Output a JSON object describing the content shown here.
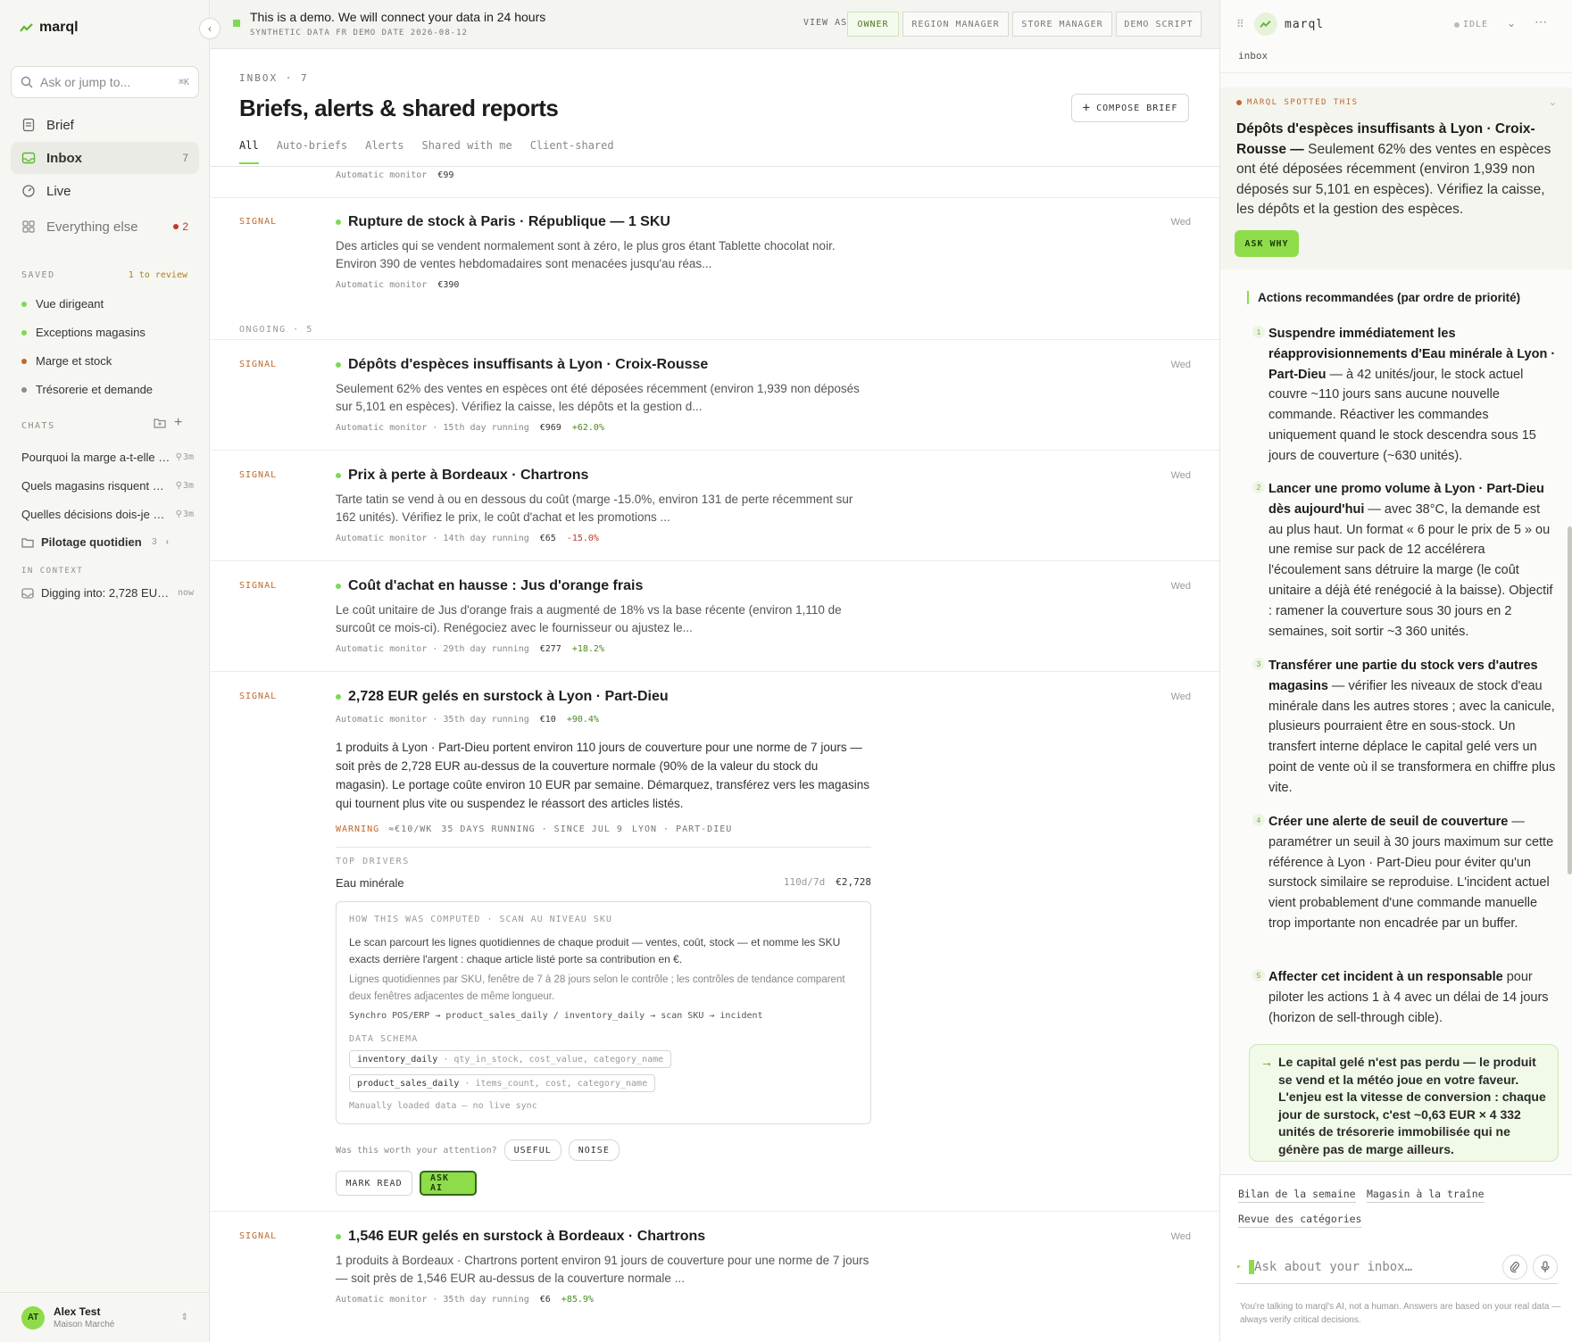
{
  "app": {
    "name": "marql"
  },
  "sidebar": {
    "search_placeholder": "Ask or jump to...",
    "search_shortcut": "⌘K",
    "nav": [
      {
        "label": "Brief"
      },
      {
        "label": "Inbox",
        "count": "7"
      },
      {
        "label": "Live"
      },
      {
        "label": "Everything else",
        "badge": "2"
      }
    ],
    "saved_label": "SAVED",
    "saved_aux": "1 to review",
    "saved": [
      {
        "label": "Vue dirigeant",
        "color": "#7ed957"
      },
      {
        "label": "Exceptions magasins",
        "color": "#7ed957"
      },
      {
        "label": "Marge et stock",
        "color": "#c0682b"
      },
      {
        "label": "Trésorerie et demande",
        "color": "#8d8d88"
      }
    ],
    "chats_label": "CHATS",
    "chats": [
      {
        "title": "Pourquoi la marge a-t-elle baissé",
        "meta": "3m"
      },
      {
        "title": "Quels magasins risquent une rupture",
        "meta": "3m"
      },
      {
        "title": "Quelles décisions dois-je prendre",
        "meta": "3m"
      }
    ],
    "folder": {
      "title": "Pilotage quotidien",
      "count": "3"
    },
    "context_label": "IN CONTEXT",
    "context_item": {
      "title": "Digging into: 2,728 EUR gelés",
      "meta": "now"
    },
    "user": {
      "initials": "AT",
      "name": "Alex Test",
      "org": "Maison Marché"
    }
  },
  "banner": {
    "title": "This is a demo. We will connect your data in 24 hours",
    "subtitle": "SYNTHETIC DATA  FR  DEMO DATE 2026-08-12",
    "view_as": "VIEW AS",
    "roles": [
      "OWNER",
      "REGION MANAGER",
      "STORE MANAGER",
      "DEMO SCRIPT"
    ]
  },
  "inbox": {
    "eyebrow": "INBOX · 7",
    "title": "Briefs, alerts & shared reports",
    "compose": "COMPOSE BRIEF",
    "tabs": [
      "All",
      "Auto-briefs",
      "Alerts",
      "Shared with me",
      "Client-shared"
    ],
    "top_meta": {
      "source": "Automatic monitor",
      "value": "€99"
    },
    "ongoing_label": "ONGOING · 5",
    "items": [
      {
        "tag": "SIGNAL",
        "title": "Rupture de stock à Paris · République — 1 SKU",
        "body": "Des articles qui se vendent normalement sont à zéro, le plus gros étant Tablette chocolat noir. Environ 390 de ventes hebdomadaires sont menacées jusqu'au réas...",
        "meta": "Automatic monitor",
        "value": "€390",
        "change": "",
        "day": "Wed"
      },
      {
        "tag": "SIGNAL",
        "title": "Dépôts d'espèces insuffisants à Lyon · Croix-Rousse",
        "body": "Seulement 62% des ventes en espèces ont été déposées récemment (environ 1,939 non déposés sur 5,101 en espèces). Vérifiez la caisse, les dépôts et la gestion d...",
        "meta": "Automatic monitor · 15th day running",
        "value": "€969",
        "change": "+62.0%",
        "day": "Wed"
      },
      {
        "tag": "SIGNAL",
        "title": "Prix à perte à Bordeaux · Chartrons",
        "body": "Tarte tatin se vend à ou en dessous du coût (marge -15.0%, environ 131 de perte récemment sur 162 unités). Vérifiez le prix, le coût d'achat et les promotions ...",
        "meta": "Automatic monitor · 14th day running",
        "value": "€65",
        "change": "-15.0%",
        "day": "Wed"
      },
      {
        "tag": "SIGNAL",
        "title": "Coût d'achat en hausse : Jus d'orange frais",
        "body": "Le coût unitaire de Jus d'orange frais a augmenté de 18% vs la base récente (environ 1,110 de surcoût ce mois-ci). Renégociez avec le fournisseur ou ajustez le...",
        "meta": "Automatic monitor · 29th day running",
        "value": "€277",
        "change": "+18.2%",
        "day": "Wed"
      }
    ],
    "expanded": {
      "tag": "SIGNAL",
      "title": "2,728 EUR gelés en surstock à Lyon · Part-Dieu",
      "meta": "Automatic monitor · 35th day running",
      "value": "€10",
      "change": "+90.4%",
      "day": "Wed",
      "body": "1 produits à Lyon · Part-Dieu portent environ 110 jours de couverture pour une norme de 7 jours — soit près de 2,728 EUR au-dessus de la couverture normale (90% de la valeur du stock du magasin). Le portage coûte environ 10 EUR par semaine. Démarquez, transférez vers les magasins qui tournent plus vite ou suspendez le réassort des articles listés.",
      "warning": "WARNING",
      "warning_details": [
        "≈€10/WK",
        "35 DAYS RUNNING · SINCE JUL 9",
        "LYON · PART-DIEU"
      ],
      "drivers_label": "TOP DRIVERS",
      "driver": {
        "name": "Eau minérale",
        "rate": "110d/7d",
        "value": "€2,728"
      },
      "computed": {
        "label": "HOW THIS WAS COMPUTED · SCAN AU NIVEAU SKU",
        "p1": "Le scan parcourt les lignes quotidiennes de chaque produit — ventes, coût, stock — et nomme les SKU exacts derrière l'argent : chaque article listé porte sa contribution en €.",
        "p2": "Lignes quotidiennes par SKU, fenêtre de 7 à 28 jours selon le contrôle ; les contrôles de tendance comparent deux fenêtres adjacentes de même longueur.",
        "flow": "Synchro POS/ERP → product_sales_daily / inventory_daily → scan SKU → incident",
        "schema_label": "DATA SCHEMA",
        "schema": [
          {
            "table": "inventory_daily",
            "fields": "· qty_in_stock, cost_value, category_name"
          },
          {
            "table": "product_sales_daily",
            "fields": "· items_count, cost, category_name"
          }
        ],
        "note": "Manually loaded data — no live sync"
      },
      "worth": "Was this worth your attention?",
      "useful": "USEFUL",
      "noise": "NOISE",
      "mark_read": "MARK READ",
      "ask_ai": "ASK AI"
    },
    "last": {
      "tag": "SIGNAL",
      "title": "1,546 EUR gelés en surstock à Bordeaux · Chartrons",
      "body": "1 produits à Bordeaux · Chartrons portent environ 91 jours de couverture pour une norme de 7 jours — soit près de 1,546 EUR au-dessus de la couverture normale ...",
      "meta": "Automatic monitor · 35th day running",
      "value": "€6",
      "change": "+85.9%",
      "day": "Wed"
    }
  },
  "assistant": {
    "name": "marql",
    "status": "IDLE",
    "context": "inbox",
    "spotted_label": "MARQL SPOTTED THIS",
    "spotted_bold": "Dépôts d'espèces insuffisants à Lyon · Croix-Rousse —",
    "spotted_text": " Seulement 62% des ventes en espèces ont été déposées récemment (environ 1,939 non déposés sur 5,101 en espèces). Vérifiez la caisse, les dépôts et la gestion des espèces.",
    "ask_why": "ASK WHY",
    "rec_title": "Actions recommandées (par ordre de priorité)",
    "steps": [
      {
        "n": "1",
        "bold": "Suspendre immédiatement les réapprovisionnements d'Eau minérale à Lyon · Part-Dieu",
        "text": " — à 42 unités/jour, le stock actuel couvre ~110 jours sans aucune nouvelle commande. Réactiver les commandes uniquement quand le stock descendra sous 15 jours de couverture (~630 unités)."
      },
      {
        "n": "2",
        "bold": "Lancer une promo volume à Lyon · Part-Dieu dès aujourd'hui",
        "text": " — avec 38°C, la demande est au plus haut. Un format « 6 pour le prix de 5 » ou une remise sur pack de 12 accélérera l'écoulement sans détruire la marge (le coût unitaire a déjà été renégocié à la baisse). Objectif : ramener la couverture sous 30 jours en 2 semaines, soit sortir ~3 360 unités."
      },
      {
        "n": "3",
        "bold": "Transférer une partie du stock vers d'autres magasins",
        "text": " — vérifier les niveaux de stock d'eau minérale dans les autres stores ; avec la canicule, plusieurs pourraient être en sous-stock. Un transfert interne déplace le capital gelé vers un point de vente où il se transformera en chiffre plus vite."
      },
      {
        "n": "4",
        "bold": "Créer une alerte de seuil de couverture",
        "text": " — paramétrer un seuil à 30 jours maximum sur cette référence à Lyon · Part-Dieu pour éviter qu'un surstock similaire se reproduise. L'incident actuel vient probablement d'une commande manuelle trop importante non encadrée par un buffer."
      },
      {
        "n": "5",
        "bold": "Affecter cet incident à un responsable",
        "text": " pour piloter les actions 1 à 4 avec un délai de 14 jours (horizon de sell-through cible)."
      }
    ],
    "callout": "Le capital gelé n'est pas perdu — le produit se vend et la météo joue en votre faveur. L'enjeu est la vitesse de conversion : chaque jour de surstock, c'est ~0,63 EUR × 4 332 unités de trésorerie immobilisée qui ne génère pas de marge ailleurs.",
    "suggestions": [
      "Bilan de la semaine",
      "Magasin à la traîne",
      "Revue des catégories"
    ],
    "input_placeholder": "Ask about your inbox…",
    "disclaimer": "You're talking to marql's AI, not a human. Answers are based on your real data — always verify critical decisions."
  }
}
